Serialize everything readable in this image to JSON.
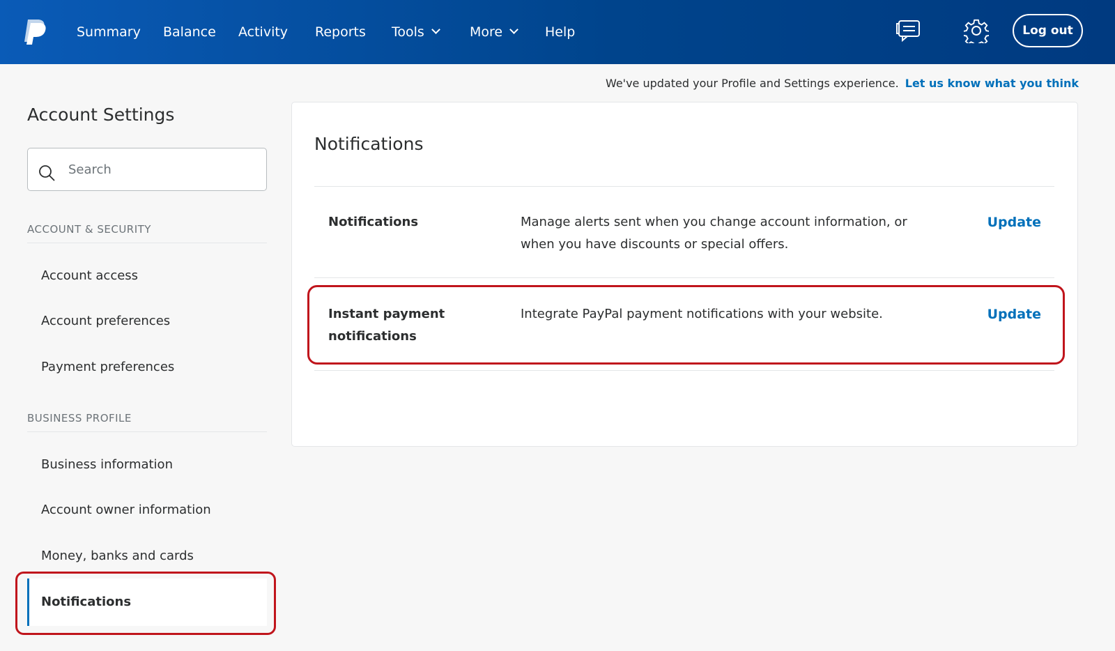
{
  "nav": {
    "items": [
      "Summary",
      "Balance",
      "Activity",
      "Reports",
      "Tools",
      "More",
      "Help"
    ],
    "logout_label": "Log out"
  },
  "banner": {
    "text": "We've updated your Profile and Settings experience.",
    "link": "Let us know what you think"
  },
  "sidebar": {
    "title": "Account Settings",
    "search_placeholder": "Search",
    "sections": [
      {
        "heading": "ACCOUNT & SECURITY",
        "items": [
          "Account access",
          "Account preferences",
          "Payment preferences"
        ]
      },
      {
        "heading": "BUSINESS PROFILE",
        "items": [
          "Business information",
          "Account owner information",
          "Money, banks and cards"
        ]
      }
    ],
    "active_item": "Notifications"
  },
  "main": {
    "title": "Notifications",
    "rows": [
      {
        "label": "Notifications",
        "description": "Manage alerts sent when you change account information, or when you have discounts or special offers.",
        "action": "Update"
      },
      {
        "label": "Instant payment notifications",
        "description": "Integrate PayPal payment notifications with your website.",
        "action": "Update"
      }
    ]
  },
  "colors": {
    "nav_gradient_start": "#0a5bb7",
    "nav_gradient_end": "#003a80",
    "link_blue": "#0070ba",
    "highlight_red": "#c0151c"
  },
  "icons": [
    "paypal-logo",
    "message-center-icon",
    "gear-icon",
    "search-icon",
    "chevron-down-icon"
  ]
}
